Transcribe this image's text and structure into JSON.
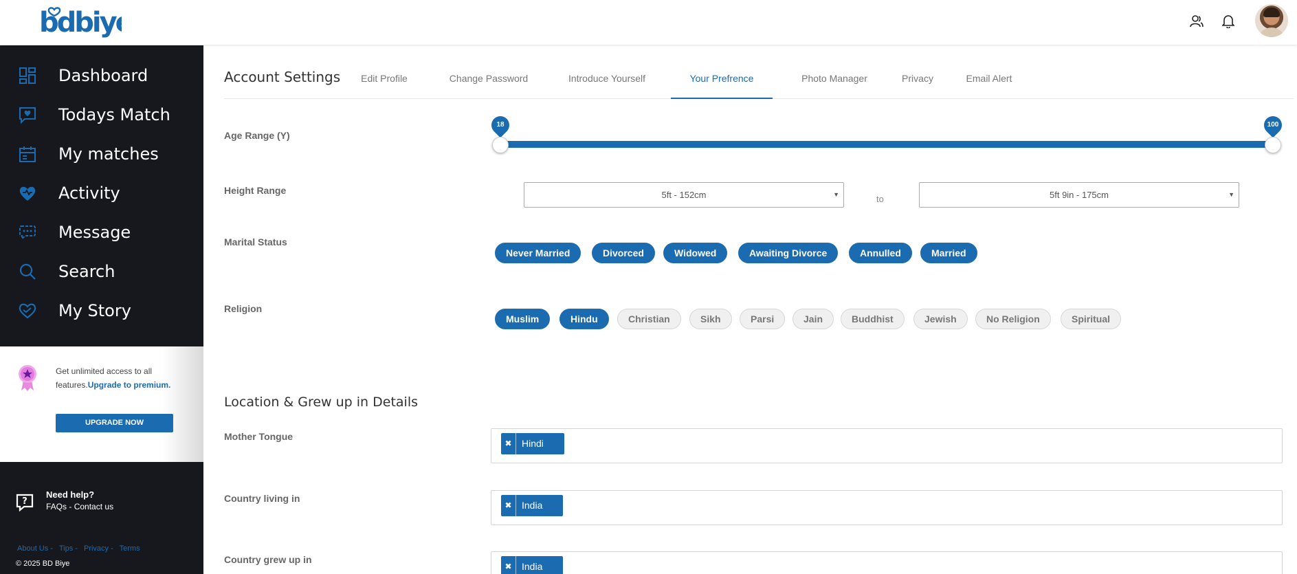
{
  "brand": {
    "logo_text": "bdbiye",
    "accent": "#1b6bb0",
    "sidebar_bg": "#16181d"
  },
  "topbar": {
    "icons": [
      "users-icon",
      "bell-icon"
    ]
  },
  "sidebar": {
    "items": [
      {
        "label": "Dashboard",
        "icon": "dashboard-icon"
      },
      {
        "label": "Todays Match",
        "icon": "heart-chat-icon"
      },
      {
        "label": "My matches",
        "icon": "calendar-icon"
      },
      {
        "label": "Activity",
        "icon": "activity-heart-icon"
      },
      {
        "label": "Message",
        "icon": "message-icon"
      },
      {
        "label": "Search",
        "icon": "search-icon"
      },
      {
        "label": "My Story",
        "icon": "story-heart-icon"
      }
    ],
    "promo": {
      "text_plain": "Get unlimited access to all features.",
      "text_link": "Upgrade to premium.",
      "button": "UPGRADE NOW"
    },
    "help": {
      "title": "Need help?",
      "faqs": "FAQs",
      "sep": "-",
      "contact": "Contact us"
    },
    "footer_links": [
      "About Us -",
      "Tips -",
      "Privacy -",
      "Terms"
    ],
    "copyright": "© 2025 BD Biye"
  },
  "main": {
    "heading": "Account Settings",
    "tabs": [
      "Edit Profile",
      "Change Password",
      "Introduce Yourself",
      "Your Prefrence",
      "Photo Manager",
      "Privacy",
      "Email Alert"
    ],
    "active_tab": "Your Prefrence",
    "age": {
      "label": "Age Range (Y)",
      "min": "18",
      "max": "100"
    },
    "height": {
      "label": "Height Range",
      "from": "5ft - 152cm",
      "to_text": "to",
      "to": "5ft 9in - 175cm"
    },
    "marital": {
      "label": "Marital Status",
      "options": [
        "Never Married",
        "Divorced",
        "Widowed",
        "Awaiting Divorce",
        "Annulled",
        "Married"
      ]
    },
    "religion": {
      "label": "Religion",
      "options": [
        "Muslim",
        "Hindu",
        "Christian",
        "Sikh",
        "Parsi",
        "Jain",
        "Buddhist",
        "Jewish",
        "No Religion",
        "Spiritual"
      ],
      "selected": [
        "Muslim",
        "Hindu"
      ]
    },
    "location_title": "Location & Grew up in Details",
    "mother_tongue": {
      "label": "Mother Tongue",
      "tag": "Hindi"
    },
    "country_living": {
      "label": "Country living in",
      "tag": "India"
    },
    "country_grew": {
      "label": "Country grew up in",
      "tag": "India"
    }
  }
}
